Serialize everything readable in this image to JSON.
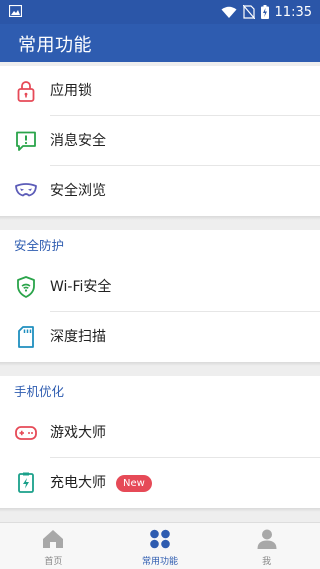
{
  "status_bar": {
    "time": "11:35"
  },
  "app_bar": {
    "title": "常用功能"
  },
  "sections": {
    "top": {
      "items": [
        {
          "label": "应用锁",
          "icon": "lock-icon",
          "color": "#e64a57"
        },
        {
          "label": "消息安全",
          "icon": "message-alert-icon",
          "color": "#2aa44a"
        },
        {
          "label": "安全浏览",
          "icon": "mask-icon",
          "color": "#5c5cb8"
        }
      ]
    },
    "security": {
      "title": "安全防护",
      "items": [
        {
          "label": "Wi-Fi安全",
          "icon": "wifi-shield-icon",
          "color": "#2aa44a"
        },
        {
          "label": "深度扫描",
          "icon": "sd-card-icon",
          "color": "#1f8fbf"
        }
      ]
    },
    "optimize": {
      "title": "手机优化",
      "items": [
        {
          "label": "游戏大师",
          "icon": "gamepad-icon",
          "color": "#e64a57"
        },
        {
          "label": "充电大师",
          "icon": "charging-icon",
          "color": "#1aa08a",
          "badge": "New"
        }
      ]
    }
  },
  "bottom_nav": {
    "items": [
      {
        "label": "首页",
        "icon": "home-icon"
      },
      {
        "label": "常用功能",
        "icon": "grid-dots-icon",
        "active": true
      },
      {
        "label": "我",
        "icon": "person-icon"
      }
    ],
    "colors": {
      "active": "#2e5cb0",
      "inactive": "#999999"
    }
  }
}
